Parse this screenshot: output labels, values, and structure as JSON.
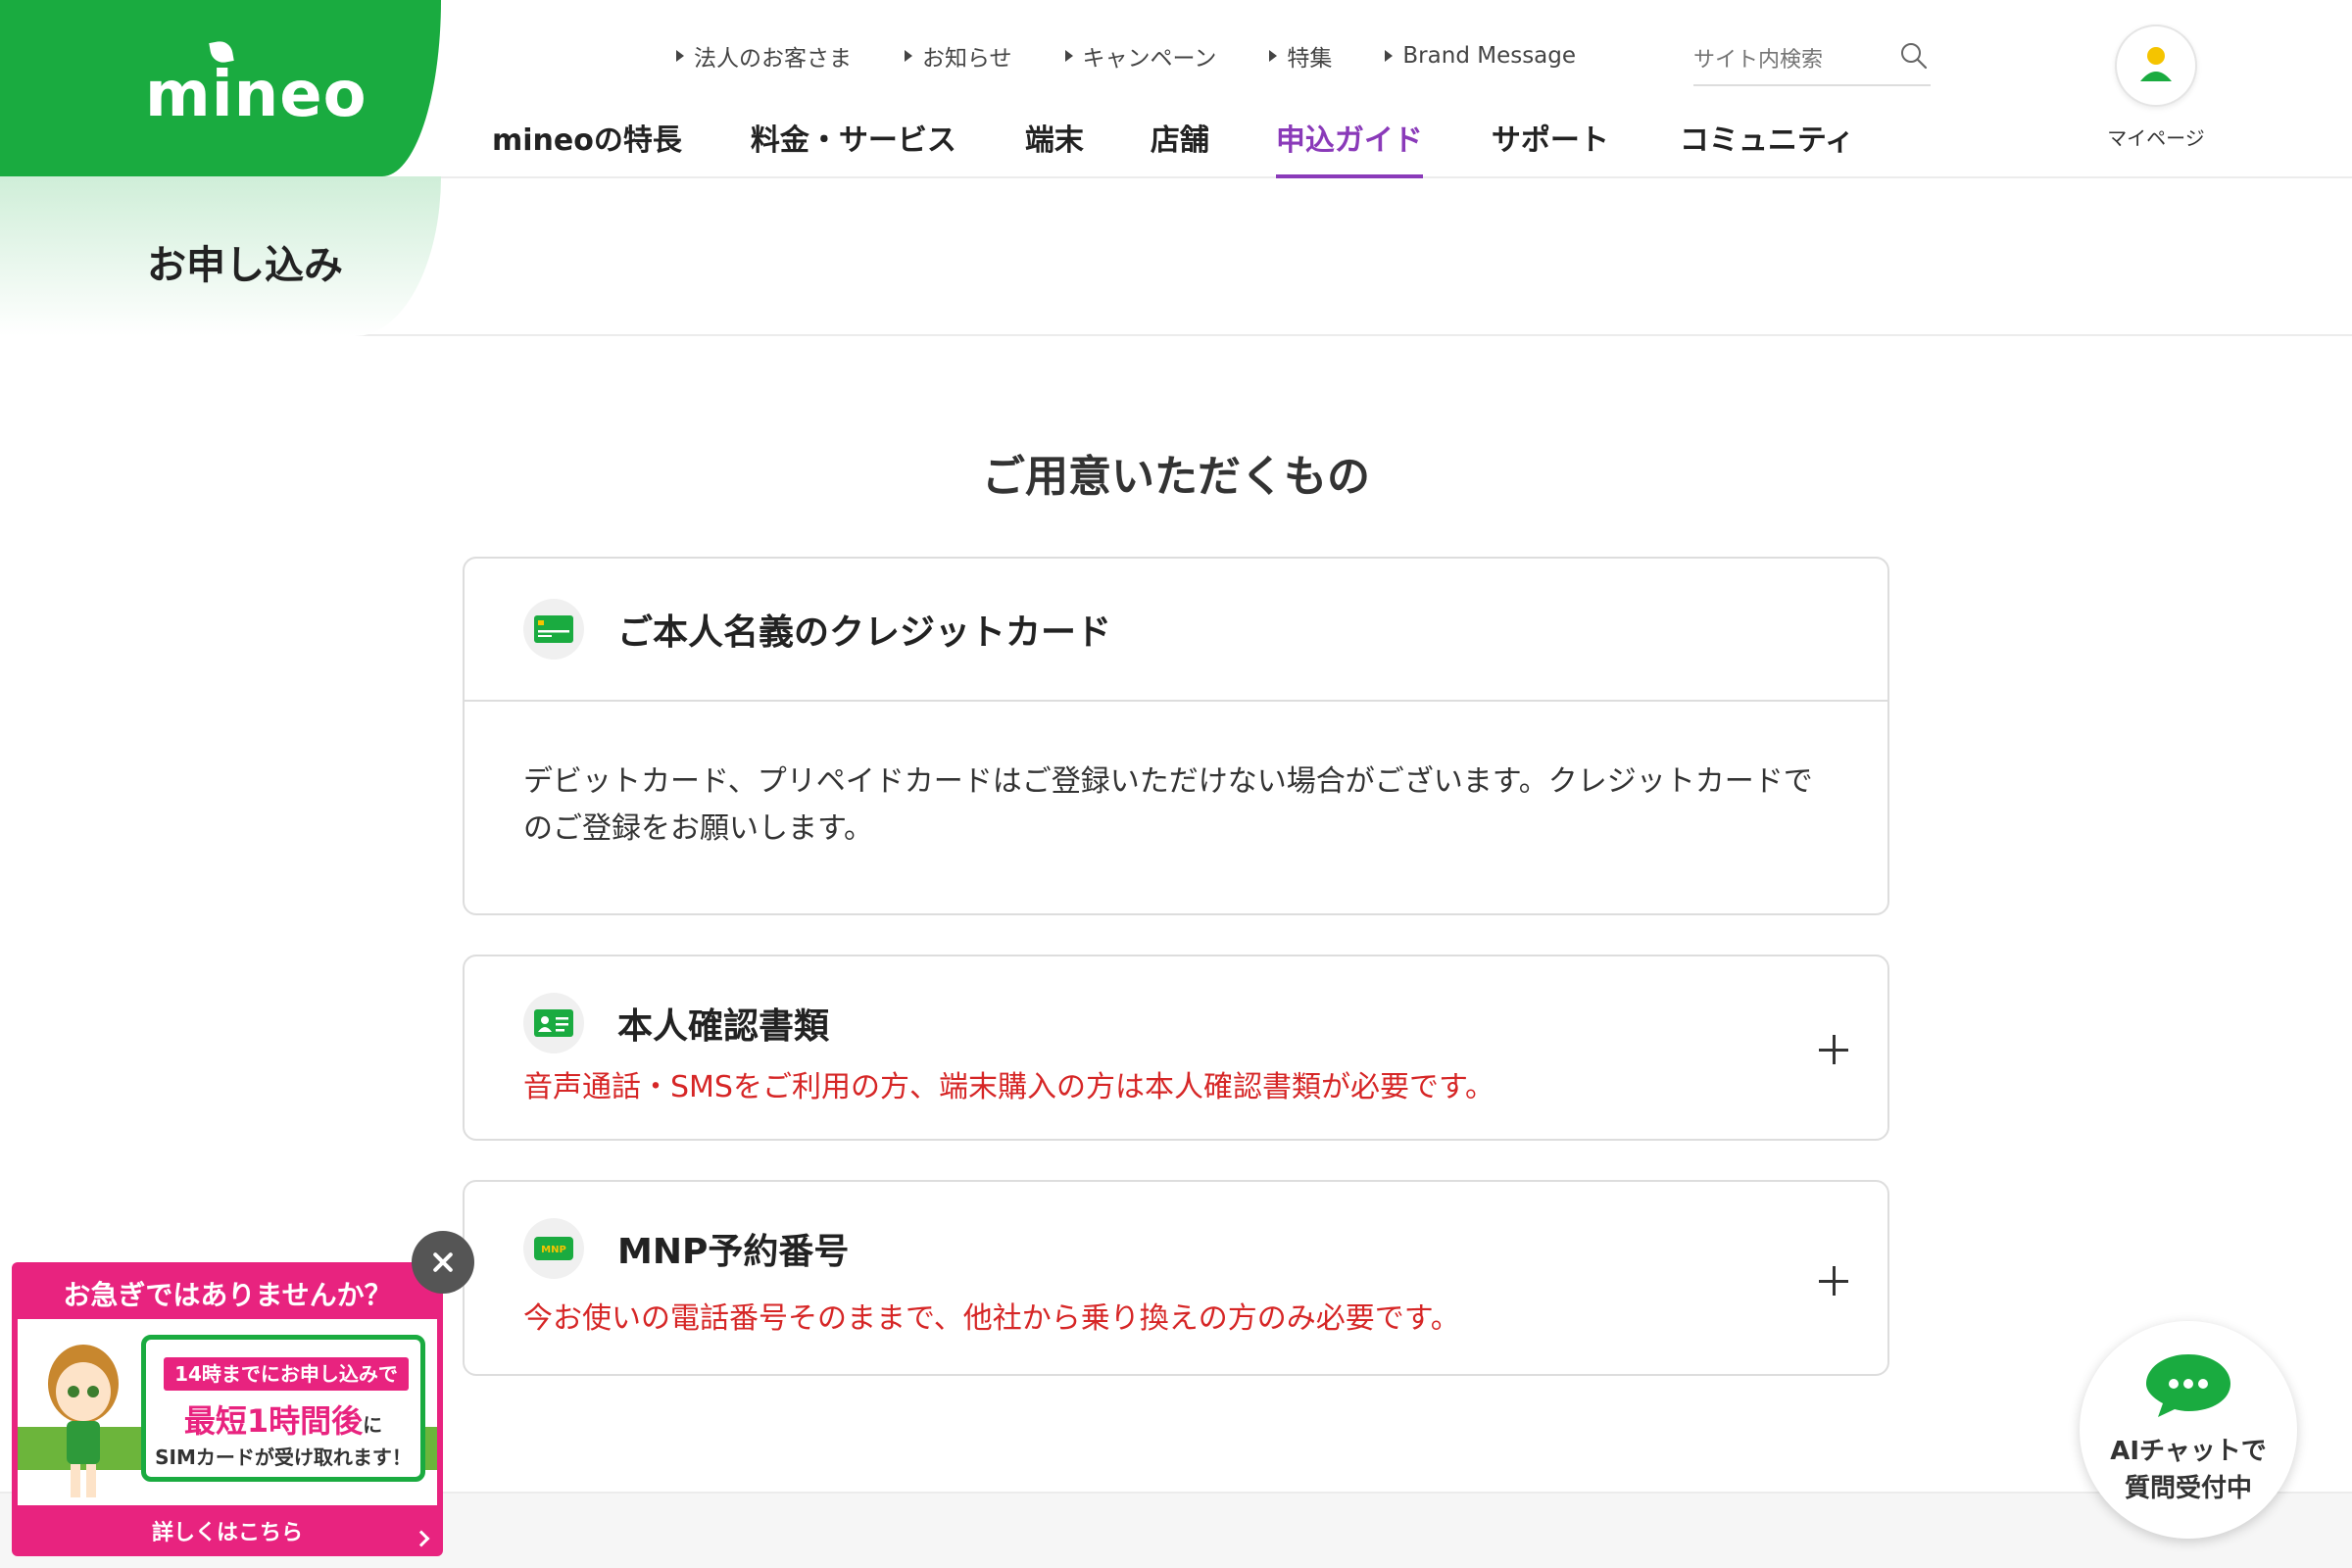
{
  "header": {
    "logo_text": "mineo",
    "utility_links": [
      {
        "label": "法人のお客さま"
      },
      {
        "label": "お知らせ"
      },
      {
        "label": "キャンペーン"
      },
      {
        "label": "特集"
      },
      {
        "label": "Brand Message"
      }
    ],
    "search_placeholder": "サイト内検索",
    "main_nav": [
      {
        "label": "mineoの特長"
      },
      {
        "label": "料金・サービス"
      },
      {
        "label": "端末"
      },
      {
        "label": "店舗"
      },
      {
        "label": "申込ガイド"
      },
      {
        "label": "サポート"
      },
      {
        "label": "コミュニティ"
      }
    ],
    "active_nav_index": 4,
    "mypage_label": "マイページ"
  },
  "page_title": "お申し込み",
  "section_title": "ご用意いただくもの",
  "cards": [
    {
      "title": "ご本人名義のクレジットカード",
      "body": "デビットカード、プリペイドカードはご登録いただけない場合がございます。クレジットカードでのご登録をお願いします。"
    },
    {
      "title": "本人確認書類",
      "note": "音声通話・SMSをご利用の方、端末購入の方は本人確認書類が必要です。"
    },
    {
      "title": "MNP予約番号",
      "icon_label": "MNP",
      "note": "今お使いの電話番号そのままで、他社から乗り換えの方のみ必要です。"
    }
  ],
  "promo": {
    "heading": "お急ぎではありませんか？",
    "line1": "14時までにお申し込みで",
    "line2_main": "最短1時間後",
    "line2_small": "に",
    "line3": "SIMカードが受け取れます！",
    "cta": "詳しくはこちら"
  },
  "ai_chat": {
    "line1": "AIチャットで",
    "line2": "質問受付中"
  },
  "colors": {
    "brand_green": "#1aab40",
    "accent_purple": "#8a3ab9",
    "note_red": "#d62626",
    "promo_pink": "#e8237f"
  }
}
